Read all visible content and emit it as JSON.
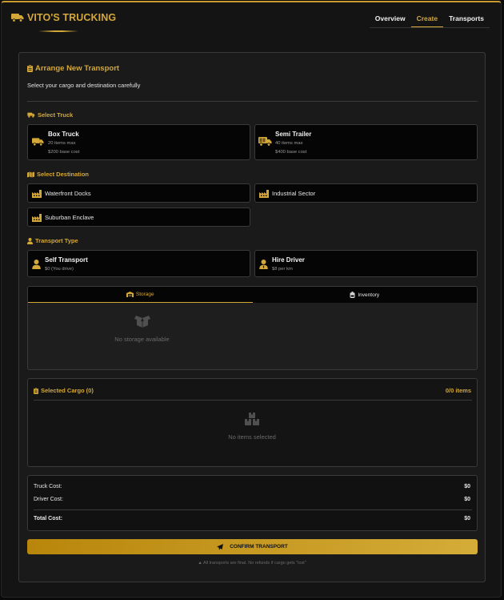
{
  "brand": {
    "title": "VITO'S TRUCKING"
  },
  "nav": {
    "tabs": [
      "Overview",
      "Create",
      "Transports"
    ],
    "active": "Create"
  },
  "form": {
    "title": "Arrange New Transport",
    "subtitle": "Select your cargo and destination carefully",
    "truck_section": "Select Truck",
    "trucks": [
      {
        "name": "Box Truck",
        "capacity": "20 items max",
        "cost": "$200 base cost"
      },
      {
        "name": "Semi Trailer",
        "capacity": "40 items max",
        "cost": "$400 base cost"
      }
    ],
    "destination_section": "Select Destination",
    "destinations": [
      "Waterfront Docks",
      "Industrial Sector",
      "Suburban Enclave"
    ],
    "transport_section": "Transport Type",
    "transport_types": [
      {
        "name": "Self Transport",
        "detail": "$0 (You drive)"
      },
      {
        "name": "Hire Driver",
        "detail": "$8 per km"
      }
    ],
    "source_tabs": [
      "Storage",
      "Inventory"
    ],
    "storage_empty": "No storage available",
    "cargo": {
      "title": "Selected Cargo (0)",
      "count": "0/0 items",
      "empty": "No items selected"
    },
    "costs": {
      "truck_label": "Truck Cost:",
      "truck_value": "$0",
      "driver_label": "Driver Cost:",
      "driver_value": "$0",
      "total_label": "Total Cost:",
      "total_value": "$0"
    },
    "confirm_label": "CONFIRM TRANSPORT",
    "disclaimer": "All transports are final. No refunds if cargo gets \"lost\""
  },
  "colors": {
    "accent": "#d4a838",
    "background": "#141414",
    "card": "#050505"
  },
  "icons": [
    "truck-icon",
    "clipboard-icon",
    "map-icon",
    "building-icon",
    "user-icon",
    "user-tie-icon",
    "warehouse-icon",
    "backpack-icon",
    "box-open-icon",
    "boxes-icon",
    "paper-plane-icon",
    "warning-icon"
  ]
}
